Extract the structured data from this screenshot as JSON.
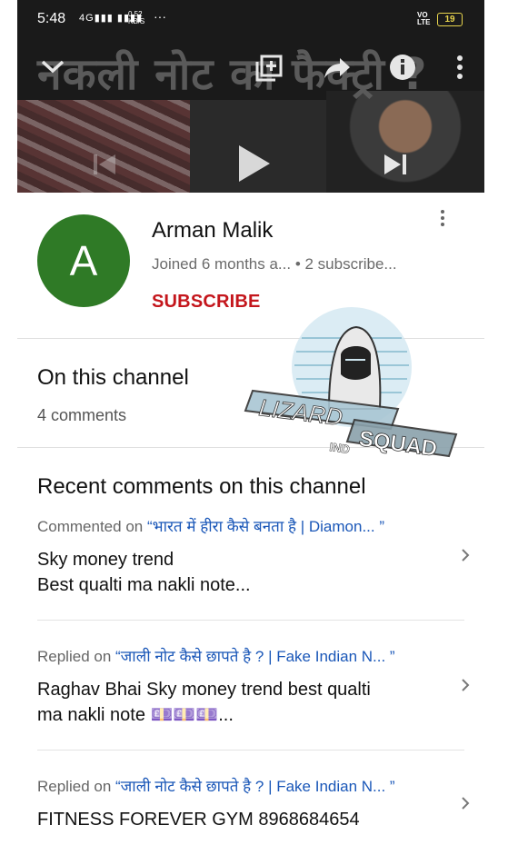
{
  "status_bar": {
    "time": "5:48",
    "signal": "4G",
    "net_speed_value": "0.52",
    "net_speed_unit": "KB/S",
    "overflow": "···",
    "volte_top": "VO",
    "volte_bottom": "LTE",
    "battery": "19"
  },
  "video": {
    "title_overlay": "नकली नोट का फैक्ट्री ?",
    "controls": [
      "collapse",
      "add-to-playlist",
      "share",
      "info",
      "more",
      "previous",
      "play",
      "next"
    ]
  },
  "channel": {
    "avatar_letter": "A",
    "avatar_color": "#2f7a26",
    "name": "Arman Malik",
    "meta": "Joined 6 months a... • 2 subscribe...",
    "subscribe_label": "SUBSCRIBE",
    "subscribe_color": "#c4161c"
  },
  "on_channel": {
    "title": "On this channel",
    "count": "4 comments"
  },
  "recent": {
    "title": "Recent comments on this channel",
    "comments": [
      {
        "action": "Commented on",
        "video_title": "“भारत में हीरा कैसे बनता है | Diamon... ”",
        "line1": "Sky money trend",
        "line2": "Best qualti ma nakli note..."
      },
      {
        "action": "Replied on",
        "video_title": "“जाली नोट कैसे छापते है ? | Fake Indian N... ”",
        "line1": "Raghav Bhai Sky money trend best qualti",
        "line2": "ma nakli note 💷💷💷..."
      },
      {
        "action": "Replied on",
        "video_title": "“जाली नोट कैसे छापते है ? | Fake Indian N... ”",
        "line1": "FITNESS FOREVER GYM 8968684654",
        "line2": ""
      }
    ]
  },
  "watermark": {
    "text1": "LIZARD",
    "text2": "SQUAD",
    "text3": "IND"
  }
}
